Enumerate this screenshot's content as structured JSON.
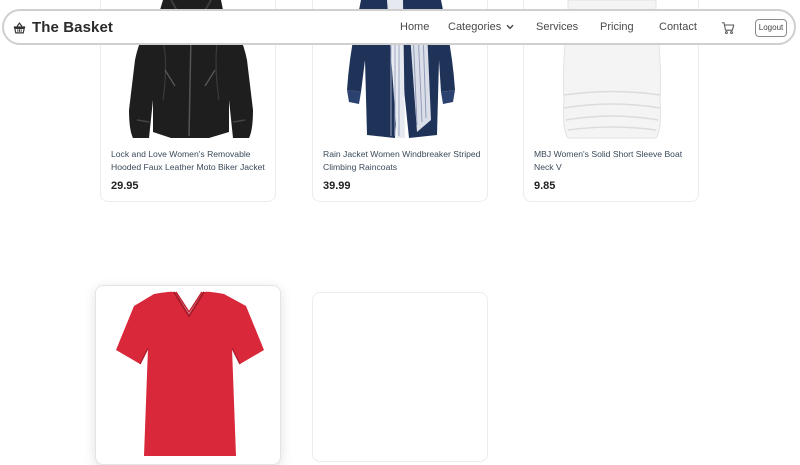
{
  "navbar": {
    "brand": "The Basket",
    "brand_icon": "basket-icon",
    "links": {
      "home": "Home",
      "categories": "Categories",
      "services": "Services",
      "pricing": "Pricing",
      "contact": "Contact"
    },
    "cart_icon": "cart-icon",
    "logout": "Logout"
  },
  "products": [
    {
      "title": "Lock and Love Women's Removable Hooded Faux Leather Moto Biker Jacket",
      "price": "29.95",
      "image": "black-leather-jacket-image"
    },
    {
      "title": "Rain Jacket Women Windbreaker Striped Climbing Raincoats",
      "price": "39.99",
      "image": "navy-raincoat-image"
    },
    {
      "title": "MBJ Women's Solid Short Sleeve Boat Neck V",
      "price": "9.85",
      "image": "white-top-image"
    },
    {
      "title": "",
      "price": "",
      "image": "red-vneck-tshirt-image"
    },
    {
      "title": "",
      "price": "",
      "image": ""
    }
  ]
}
